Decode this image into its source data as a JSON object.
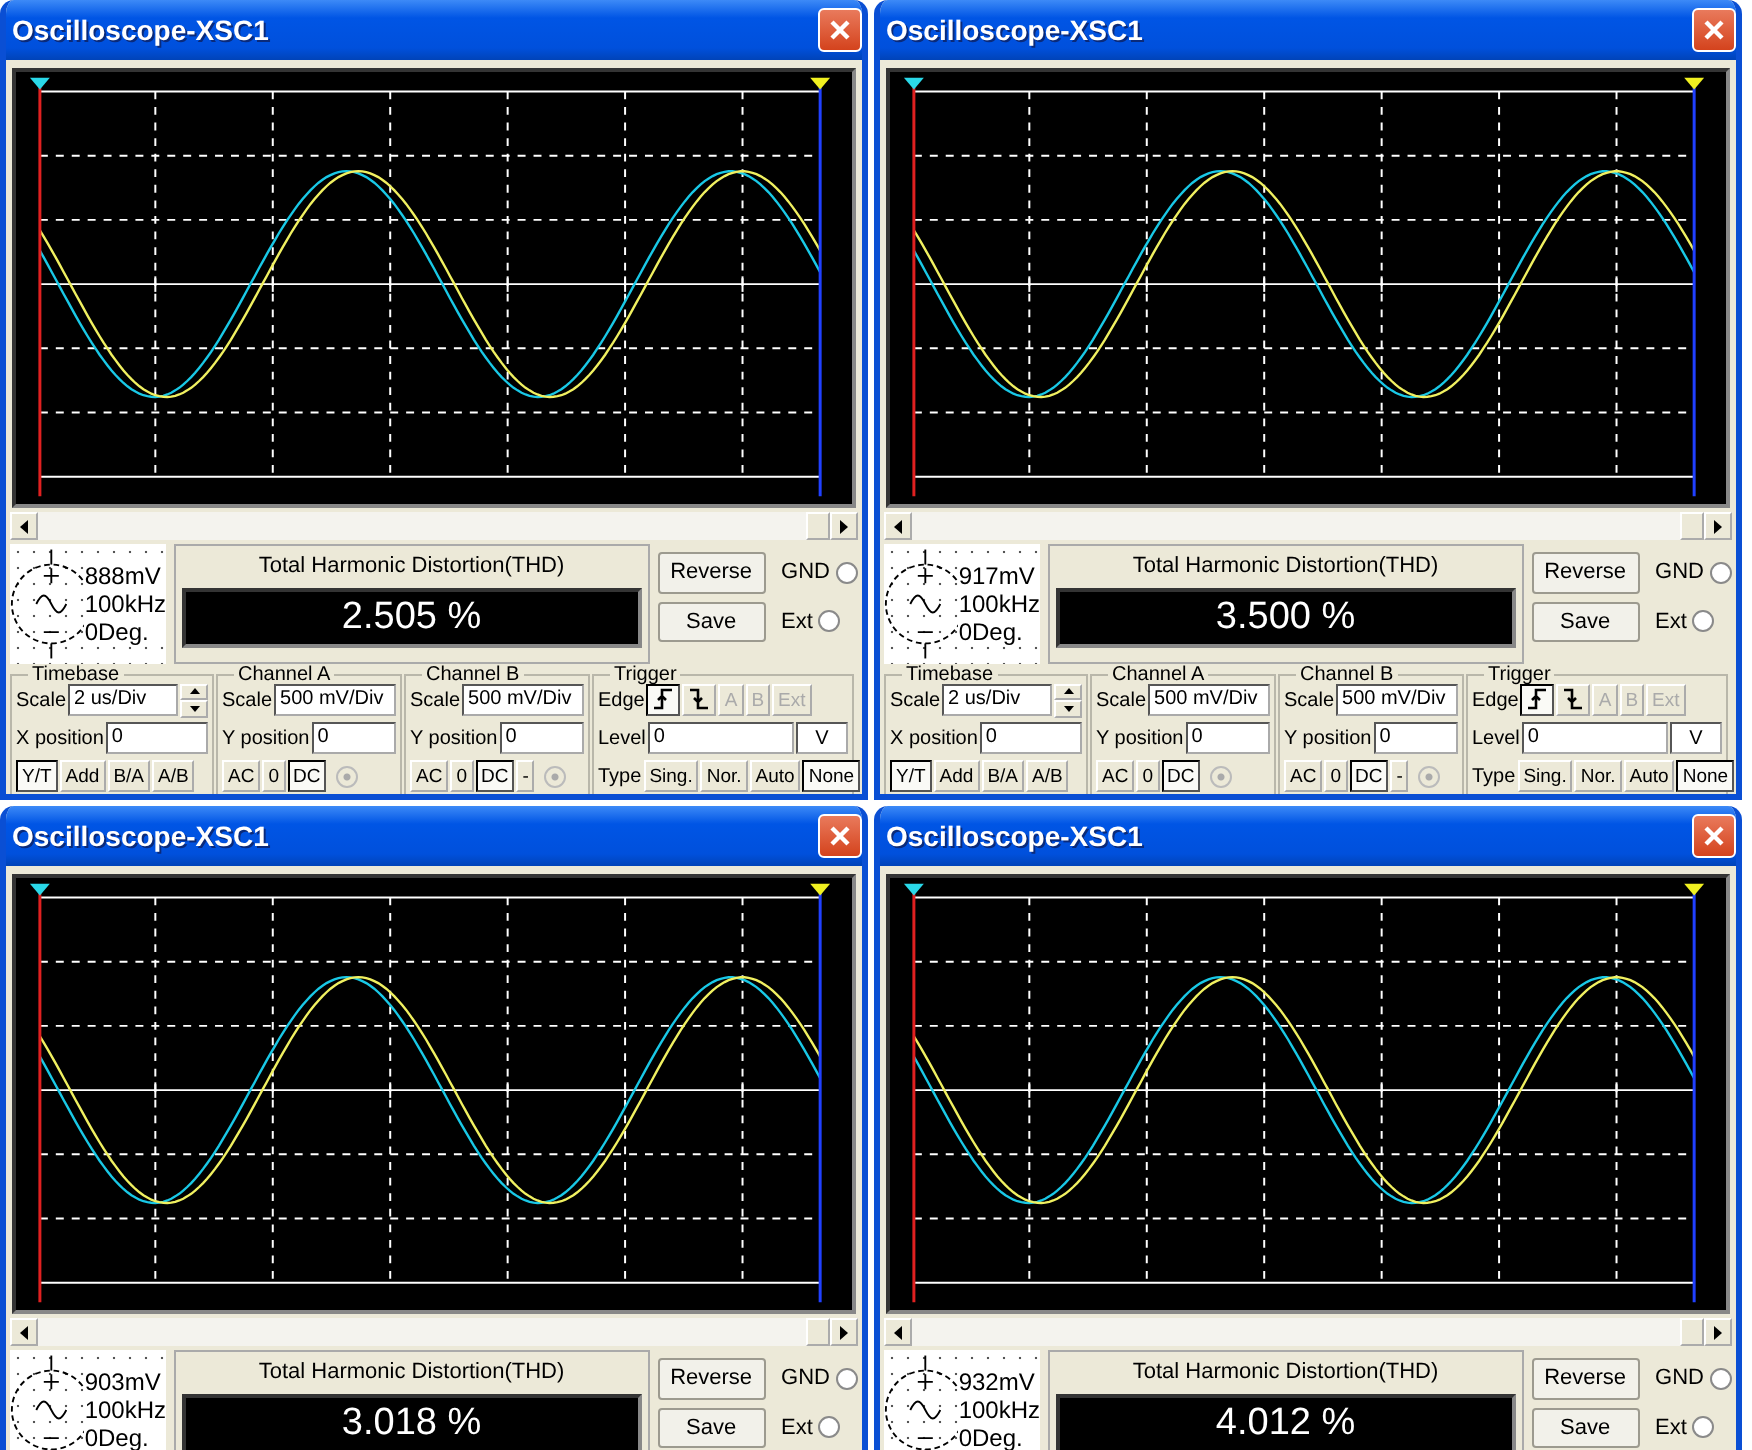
{
  "windows": [
    {
      "title": "Oscilloscope-XSC1",
      "source": {
        "amplitude": "888mV",
        "frequency": "100kHz",
        "phase": "0Deg."
      },
      "thd": {
        "label": "Total Harmonic Distortion(THD)",
        "value": "2.505 %"
      },
      "buttons": [
        "Reverse",
        "Save"
      ],
      "radios": [
        {
          "label": "GND",
          "selected": false
        },
        {
          "label": "Ext",
          "selected": false
        }
      ],
      "controls": [
        {
          "kind": "timebase",
          "title": "Timebase",
          "lines": [
            {
              "items": [
                {
                  "kind": "label",
                  "text": "Scale"
                },
                {
                  "kind": "field",
                  "value": "2 us/Div"
                },
                {
                  "kind": "spinner"
                }
              ]
            },
            {
              "items": [
                {
                  "kind": "label",
                  "text": "X position"
                },
                {
                  "kind": "field",
                  "value": "0"
                }
              ]
            },
            {
              "items": [
                {
                  "kind": "toggle",
                  "label": "Y/T",
                  "selected": true
                },
                {
                  "kind": "toggle",
                  "label": "Add",
                  "selected": false
                },
                {
                  "kind": "toggle",
                  "label": "B/A",
                  "selected": false
                },
                {
                  "kind": "toggle",
                  "label": "A/B",
                  "selected": false
                }
              ]
            }
          ]
        },
        {
          "kind": "channel",
          "title": "Channel A",
          "lines": [
            {
              "items": [
                {
                  "kind": "label",
                  "text": "Scale"
                },
                {
                  "kind": "field",
                  "value": "500 mV/Div"
                }
              ]
            },
            {
              "items": [
                {
                  "kind": "label",
                  "text": "Y position"
                },
                {
                  "kind": "field",
                  "value": "0"
                }
              ]
            },
            {
              "items": [
                {
                  "kind": "toggle",
                  "label": "AC",
                  "selected": false
                },
                {
                  "kind": "toggle",
                  "label": "0",
                  "selected": false
                },
                {
                  "kind": "toggle",
                  "label": "DC",
                  "selected": true
                },
                {
                  "kind": "radio",
                  "disabled": true
                }
              ]
            }
          ]
        },
        {
          "kind": "channel",
          "title": "Channel B",
          "lines": [
            {
              "items": [
                {
                  "kind": "label",
                  "text": "Scale"
                },
                {
                  "kind": "field",
                  "value": "500 mV/Div"
                }
              ]
            },
            {
              "items": [
                {
                  "kind": "label",
                  "text": "Y position"
                },
                {
                  "kind": "field",
                  "value": "0"
                }
              ]
            },
            {
              "items": [
                {
                  "kind": "toggle",
                  "label": "AC",
                  "selected": false
                },
                {
                  "kind": "toggle",
                  "label": "0",
                  "selected": false
                },
                {
                  "kind": "toggle",
                  "label": "DC",
                  "selected": true
                },
                {
                  "kind": "toggle",
                  "label": "-",
                  "selected": false
                },
                {
                  "kind": "radio",
                  "disabled": true
                }
              ]
            }
          ]
        },
        {
          "kind": "trigger",
          "title": "Trigger",
          "lines": [
            {
              "items": [
                {
                  "kind": "label",
                  "text": "Edge"
                },
                {
                  "kind": "edge_rising",
                  "selected": true
                },
                {
                  "kind": "edge_falling",
                  "selected": false
                },
                {
                  "kind": "toggle",
                  "label": "A",
                  "selected": false,
                  "disabled": true
                },
                {
                  "kind": "toggle",
                  "label": "B",
                  "selected": false,
                  "disabled": true
                },
                {
                  "kind": "toggle",
                  "label": "Ext",
                  "selected": false,
                  "disabled": true
                }
              ]
            },
            {
              "items": [
                {
                  "kind": "label",
                  "text": "Level"
                },
                {
                  "kind": "field",
                  "value": "0"
                },
                {
                  "kind": "unit",
                  "text": "V"
                }
              ]
            },
            {
              "items": [
                {
                  "kind": "label",
                  "text": "Type"
                },
                {
                  "kind": "toggle",
                  "label": "Sing.",
                  "selected": false
                },
                {
                  "kind": "toggle",
                  "label": "Nor.",
                  "selected": false
                },
                {
                  "kind": "toggle",
                  "label": "Auto",
                  "selected": false
                },
                {
                  "kind": "toggle",
                  "label": "None",
                  "selected": true
                }
              ]
            }
          ]
        }
      ]
    },
    {
      "title": "Oscilloscope-XSC1",
      "source": {
        "amplitude": "917mV",
        "frequency": "100kHz",
        "phase": "0Deg."
      },
      "thd": {
        "label": "Total Harmonic Distortion(THD)",
        "value": "3.500 %"
      },
      "buttons": [
        "Reverse",
        "Save"
      ],
      "radios": [
        {
          "label": "GND",
          "selected": false
        },
        {
          "label": "Ext",
          "selected": false
        }
      ],
      "controls": [
        {
          "kind": "timebase",
          "title": "Timebase",
          "lines": [
            {
              "items": [
                {
                  "kind": "label",
                  "text": "Scale"
                },
                {
                  "kind": "field",
                  "value": "2 us/Div"
                },
                {
                  "kind": "spinner"
                }
              ]
            },
            {
              "items": [
                {
                  "kind": "label",
                  "text": "X position"
                },
                {
                  "kind": "field",
                  "value": "0"
                }
              ]
            },
            {
              "items": [
                {
                  "kind": "toggle",
                  "label": "Y/T",
                  "selected": true
                },
                {
                  "kind": "toggle",
                  "label": "Add",
                  "selected": false
                },
                {
                  "kind": "toggle",
                  "label": "B/A",
                  "selected": false
                },
                {
                  "kind": "toggle",
                  "label": "A/B",
                  "selected": false
                }
              ]
            }
          ]
        },
        {
          "kind": "channel",
          "title": "Channel A",
          "lines": [
            {
              "items": [
                {
                  "kind": "label",
                  "text": "Scale"
                },
                {
                  "kind": "field",
                  "value": "500 mV/Div"
                }
              ]
            },
            {
              "items": [
                {
                  "kind": "label",
                  "text": "Y position"
                },
                {
                  "kind": "field",
                  "value": "0"
                }
              ]
            },
            {
              "items": [
                {
                  "kind": "toggle",
                  "label": "AC",
                  "selected": false
                },
                {
                  "kind": "toggle",
                  "label": "0",
                  "selected": false
                },
                {
                  "kind": "toggle",
                  "label": "DC",
                  "selected": true
                },
                {
                  "kind": "radio",
                  "disabled": true
                }
              ]
            }
          ]
        },
        {
          "kind": "channel",
          "title": "Channel B",
          "lines": [
            {
              "items": [
                {
                  "kind": "label",
                  "text": "Scale"
                },
                {
                  "kind": "field",
                  "value": "500 mV/Div"
                }
              ]
            },
            {
              "items": [
                {
                  "kind": "label",
                  "text": "Y position"
                },
                {
                  "kind": "field",
                  "value": "0"
                }
              ]
            },
            {
              "items": [
                {
                  "kind": "toggle",
                  "label": "AC",
                  "selected": false
                },
                {
                  "kind": "toggle",
                  "label": "0",
                  "selected": false
                },
                {
                  "kind": "toggle",
                  "label": "DC",
                  "selected": true
                },
                {
                  "kind": "toggle",
                  "label": "-",
                  "selected": false
                },
                {
                  "kind": "radio",
                  "disabled": true
                }
              ]
            }
          ]
        },
        {
          "kind": "trigger",
          "title": "Trigger",
          "lines": [
            {
              "items": [
                {
                  "kind": "label",
                  "text": "Edge"
                },
                {
                  "kind": "edge_rising",
                  "selected": true
                },
                {
                  "kind": "edge_falling",
                  "selected": false
                },
                {
                  "kind": "toggle",
                  "label": "A",
                  "selected": false,
                  "disabled": true
                },
                {
                  "kind": "toggle",
                  "label": "B",
                  "selected": false,
                  "disabled": true
                },
                {
                  "kind": "toggle",
                  "label": "Ext",
                  "selected": false,
                  "disabled": true
                }
              ]
            },
            {
              "items": [
                {
                  "kind": "label",
                  "text": "Level"
                },
                {
                  "kind": "field",
                  "value": "0"
                },
                {
                  "kind": "unit",
                  "text": "V"
                }
              ]
            },
            {
              "items": [
                {
                  "kind": "label",
                  "text": "Type"
                },
                {
                  "kind": "toggle",
                  "label": "Sing.",
                  "selected": false
                },
                {
                  "kind": "toggle",
                  "label": "Nor.",
                  "selected": false
                },
                {
                  "kind": "toggle",
                  "label": "Auto",
                  "selected": false
                },
                {
                  "kind": "toggle",
                  "label": "None",
                  "selected": true
                }
              ]
            }
          ]
        }
      ]
    },
    {
      "title": "Oscilloscope-XSC1",
      "source": {
        "amplitude": "903mV",
        "frequency": "100kHz",
        "phase": "0Deg."
      },
      "thd": {
        "label": "Total Harmonic Distortion(THD)",
        "value": "3.018 %"
      },
      "buttons": [
        "Reverse",
        "Save"
      ],
      "radios": [
        {
          "label": "GND",
          "selected": false
        },
        {
          "label": "Ext",
          "selected": false
        }
      ]
    },
    {
      "title": "Oscilloscope-XSC1",
      "source": {
        "amplitude": "932mV",
        "frequency": "100kHz",
        "phase": "0Deg."
      },
      "thd": {
        "label": "Total Harmonic Distortion(THD)",
        "value": "4.012 %"
      },
      "buttons": [
        "Reverse",
        "Save"
      ],
      "radios": [
        {
          "label": "GND",
          "selected": false
        },
        {
          "label": "Ext",
          "selected": false
        }
      ]
    }
  ]
}
